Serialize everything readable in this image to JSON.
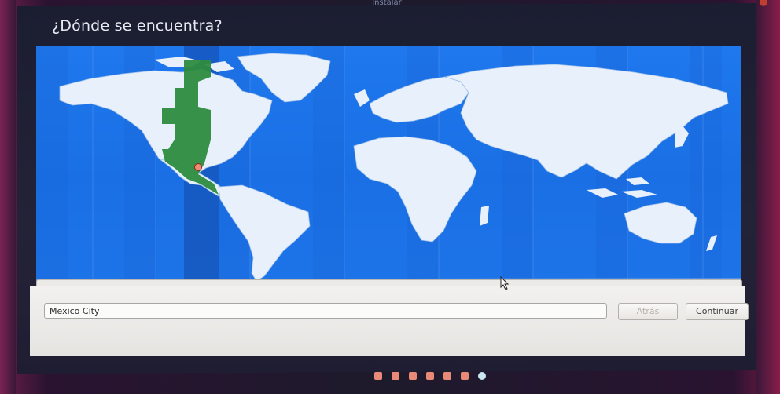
{
  "window": {
    "caption": "Instalar"
  },
  "page": {
    "title": "¿Dónde se encuentra?"
  },
  "timezone_field": {
    "value": "Mexico City"
  },
  "buttons": {
    "back": "Atrás",
    "next": "Continuar"
  },
  "progress": {
    "total_steps": 7,
    "current_step": 7
  },
  "colors": {
    "ocean": "#1d74e8",
    "land": "#e8f0fb",
    "selected_zone": "#2e8b3f",
    "panel": "#eceae7",
    "step_dot": "#e98a78",
    "step_dot_active": "#c9e6f2"
  },
  "icons": {
    "pointer": "mouse-pointer-icon",
    "location": "location-pin-icon"
  }
}
